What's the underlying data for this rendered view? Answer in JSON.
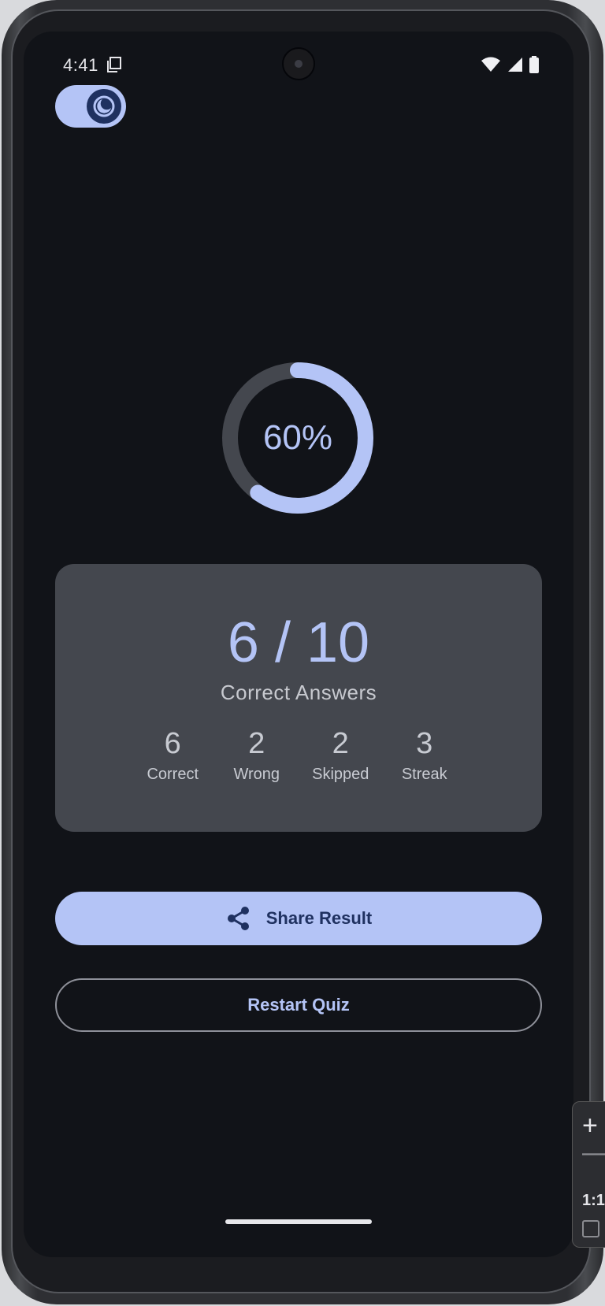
{
  "status_bar": {
    "time": "4:41"
  },
  "theme_toggle": {
    "state": "dark",
    "icon": "moon-icon"
  },
  "progress": {
    "percent_label": "60%",
    "fraction": 0.6
  },
  "score_card": {
    "score": "6 / 10",
    "subtitle": "Correct Answers",
    "stats": [
      {
        "value": "6",
        "label": "Correct"
      },
      {
        "value": "2",
        "label": "Wrong"
      },
      {
        "value": "2",
        "label": "Skipped"
      },
      {
        "value": "3",
        "label": "Streak"
      }
    ]
  },
  "actions": {
    "share_label": "Share Result",
    "share_icon": "share-icon",
    "restart_label": "Restart Quiz"
  },
  "emulator_zoom": {
    "plus": "+",
    "minus": "—",
    "ratio": "1:1"
  },
  "colors": {
    "accent": "#b4c4f6",
    "on_accent": "#1f3160",
    "background": "#111318",
    "card": "#44474e",
    "ring_track": "#44474e"
  }
}
